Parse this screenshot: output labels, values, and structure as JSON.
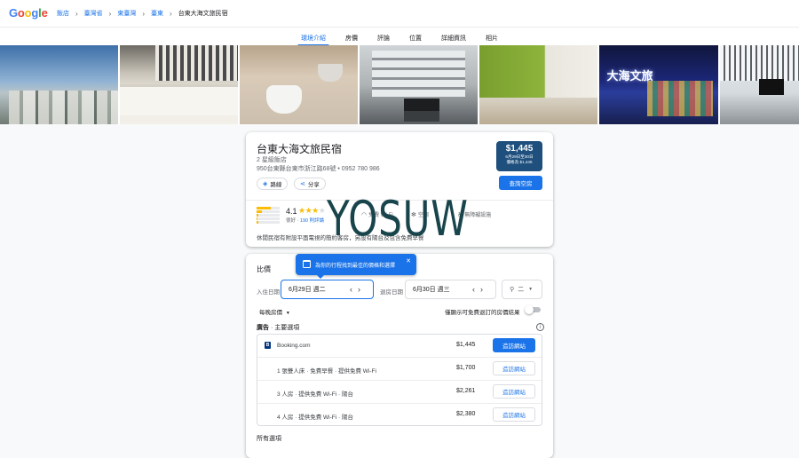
{
  "header": {
    "logo": "Google",
    "breadcrumbs": [
      "飯店",
      "臺灣省",
      "東臺灣",
      "臺東",
      "台東大海文旅民宿"
    ]
  },
  "tabs": [
    {
      "label": "環境介紹",
      "active": true
    },
    {
      "label": "房價",
      "active": false
    },
    {
      "label": "評論",
      "active": false
    },
    {
      "label": "位置",
      "active": false
    },
    {
      "label": "詳細資訊",
      "active": false
    },
    {
      "label": "相片",
      "active": false
    }
  ],
  "photos": {
    "neon_sign": "大海文旅"
  },
  "hotel": {
    "name": "台東大海文旅民宿",
    "class": "2 星級飯店",
    "address": "950台東縣台東市浙江路68號 • 0952 780 986",
    "directions_label": "路線",
    "share_label": "分享",
    "price": "$1,445",
    "price_dates": "6月29日至30日",
    "price_note": "價格為 $1,445",
    "check_label": "查詢空房",
    "rating": "4.1",
    "rating_stars": 4.1,
    "rating_label": "很好",
    "reviews": "190 則評論",
    "rating_distribution": [
      0.62,
      0.22,
      0.08,
      0.04,
      0.06
    ],
    "amenities": [
      "免費 Wi-Fi",
      "空調",
      "無障礙設施"
    ],
    "description": "休閒民宿有附設平面電視的簡約客房，另設有陽台及包含免費早餐"
  },
  "watermark": "YOSUW",
  "compare": {
    "title": "比價",
    "tooltip": "為你的行程找到最佳的價格和選擇",
    "checkin_label": "入住日期",
    "checkin_value": "6月29日 週二",
    "checkout_label": "退房日期",
    "checkout_value": "6月30日 週三",
    "guests_value": "二",
    "per_stay": "每晚房價",
    "free_cancel_label": "僅顯示可免費退訂的房價結果",
    "ads_prefix": "廣告",
    "ads_title": "主要選項",
    "offers": [
      {
        "label": "Booking.com",
        "price": "$1,445",
        "button": "造訪網站"
      },
      {
        "label": "1 張雙人床 · 免費早餐 · 提供免費 Wi-Fi",
        "price": "$1,700",
        "button": "造訪網站"
      },
      {
        "label": "3 人房 · 提供免費 Wi-Fi · 陽台",
        "price": "$2,261",
        "button": "造訪網站"
      },
      {
        "label": "4 人房 · 提供免費 Wi-Fi · 陽台",
        "price": "$2,380",
        "button": "造訪網站"
      }
    ],
    "all_options": "所有選項"
  },
  "colors": {
    "accent": "#1a73e8",
    "price_box": "#1e4f7d",
    "star": "#fbbc04"
  }
}
